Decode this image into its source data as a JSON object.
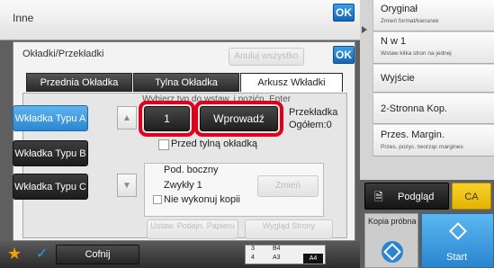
{
  "top": {
    "title": "Inne",
    "ok_label": "OK"
  },
  "right_panel": {
    "items": [
      {
        "main": "Oryginał",
        "sub": "Zmień format/kierunek"
      },
      {
        "main": "N w 1",
        "sub": "Wstaw kilka stron na jednej"
      },
      {
        "main": "Wyjście",
        "sub": ""
      },
      {
        "main": "2-Stronna Kop.",
        "sub": ""
      },
      {
        "main": "Przes. Margin.",
        "sub": "Przes. pozyc. tworząc margines"
      }
    ]
  },
  "dialog": {
    "title": "Okładki/Przekładki",
    "cancel_all_label": "Anuluj wszystko",
    "ok_label": "OK",
    "tabs": [
      {
        "label": "Przednia Okładka",
        "active": false
      },
      {
        "label": "Tylna Okładka",
        "active": false
      },
      {
        "label": "Arkusz Wkładki",
        "active": true
      }
    ],
    "instruction": "Wybierz typ do wstaw. i pozićn. Enter",
    "types": [
      "Wkładka Typu A",
      "Wkładka Typu B",
      "Wkładka Typu C"
    ],
    "page_value": "1",
    "enter_label": "Wprowadź",
    "total_label": "Przekładka",
    "total_value": "Ogółem:0",
    "before_back_cover": "Przed tylną okładką",
    "feed_label": "Pod. boczny",
    "paper_label": "Zwykły 1",
    "change_label": "Zmień",
    "no_copy_label": "Nie wykonuj kopii",
    "set_feed_label": "Ustaw. Podajn. Papieru",
    "layout_label": "Wygląd Strony"
  },
  "bottom": {
    "back_label": "Cofnij",
    "trays": [
      {
        "num": "3",
        "size": "B4"
      },
      {
        "num": "4",
        "size": "A3"
      }
    ],
    "active_size": "A4"
  },
  "actions": {
    "preview_label": "Podgląd",
    "ca_label": "CA",
    "sample_label": "Kopia próbna",
    "start_label": "Start"
  }
}
